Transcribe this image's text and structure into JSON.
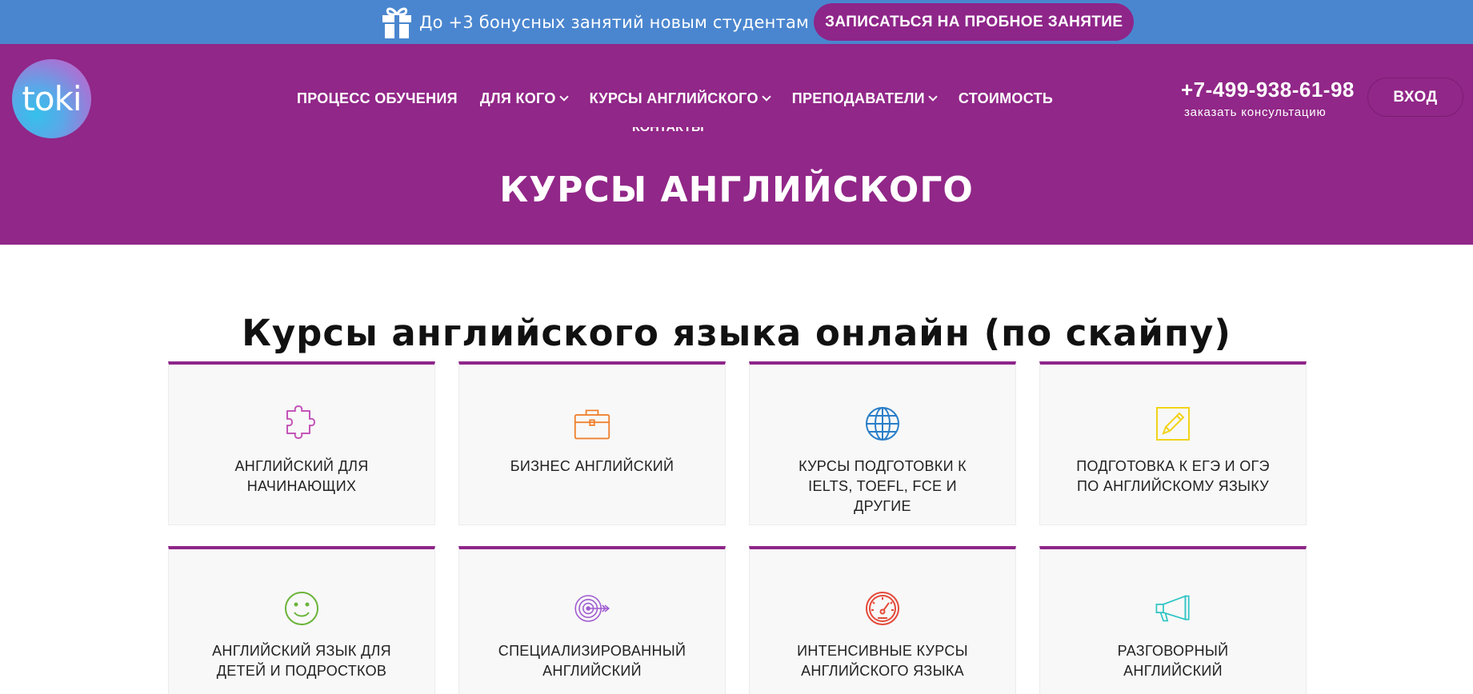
{
  "promo": {
    "text": "До +3 бонусных занятий новым студентам",
    "button_label": "ЗАПИСАТЬСЯ НА ПРОБНОЕ ЗАНЯТИЕ",
    "icon": "gift-icon"
  },
  "header": {
    "logo_text": "toki",
    "nav": [
      {
        "label": "ПРОЦЕСС ОБУЧЕНИЯ",
        "dropdown": false
      },
      {
        "label": "ДЛЯ КОГО",
        "dropdown": true
      },
      {
        "label": "КУРСЫ АНГЛИЙСКОГО",
        "dropdown": true
      },
      {
        "label": "ПРЕПОДАВАТЕЛИ",
        "dropdown": true
      },
      {
        "label": "СТОИМОСТЬ",
        "dropdown": false
      }
    ],
    "nav_overflow_label": "КОНТАКТЫ",
    "phone": "+7-499-938-61-98",
    "consult_label": "заказать консультацию",
    "login_label": "ВХОД",
    "page_title": "КУРСЫ АНГЛИЙСКОГО"
  },
  "main": {
    "section_title": "Курсы английского языка онлайн (по скайпу)",
    "cards": [
      {
        "title": "Английский для начинающих",
        "icon": "puzzle-icon",
        "color": "#c455b8"
      },
      {
        "title": "Бизнес английский",
        "icon": "briefcase-icon",
        "color": "#f0812e"
      },
      {
        "title": "Курсы подготовки к IELTS, TOEFL, FCE и другие",
        "icon": "globe-icon",
        "color": "#2a7ec8"
      },
      {
        "title": "Подготовка к ЕГЭ и ОГЭ по английскому языку",
        "icon": "pencil-icon",
        "color": "#f2d318"
      },
      {
        "title": "Английский язык для детей и подростков",
        "icon": "smiley-icon",
        "color": "#6bb43a"
      },
      {
        "title": "Специализированный английский",
        "icon": "target-icon",
        "color": "#a05cd0"
      },
      {
        "title": "Интенсивные курсы английского языка",
        "icon": "speedometer-icon",
        "color": "#e44a3a"
      },
      {
        "title": "Разговорный английский",
        "icon": "megaphone-icon",
        "color": "#2ec4c4"
      }
    ]
  },
  "colors": {
    "promo_bar": "#4a86cf",
    "brand_purple": "#912788",
    "button_purple": "#8e2589"
  }
}
